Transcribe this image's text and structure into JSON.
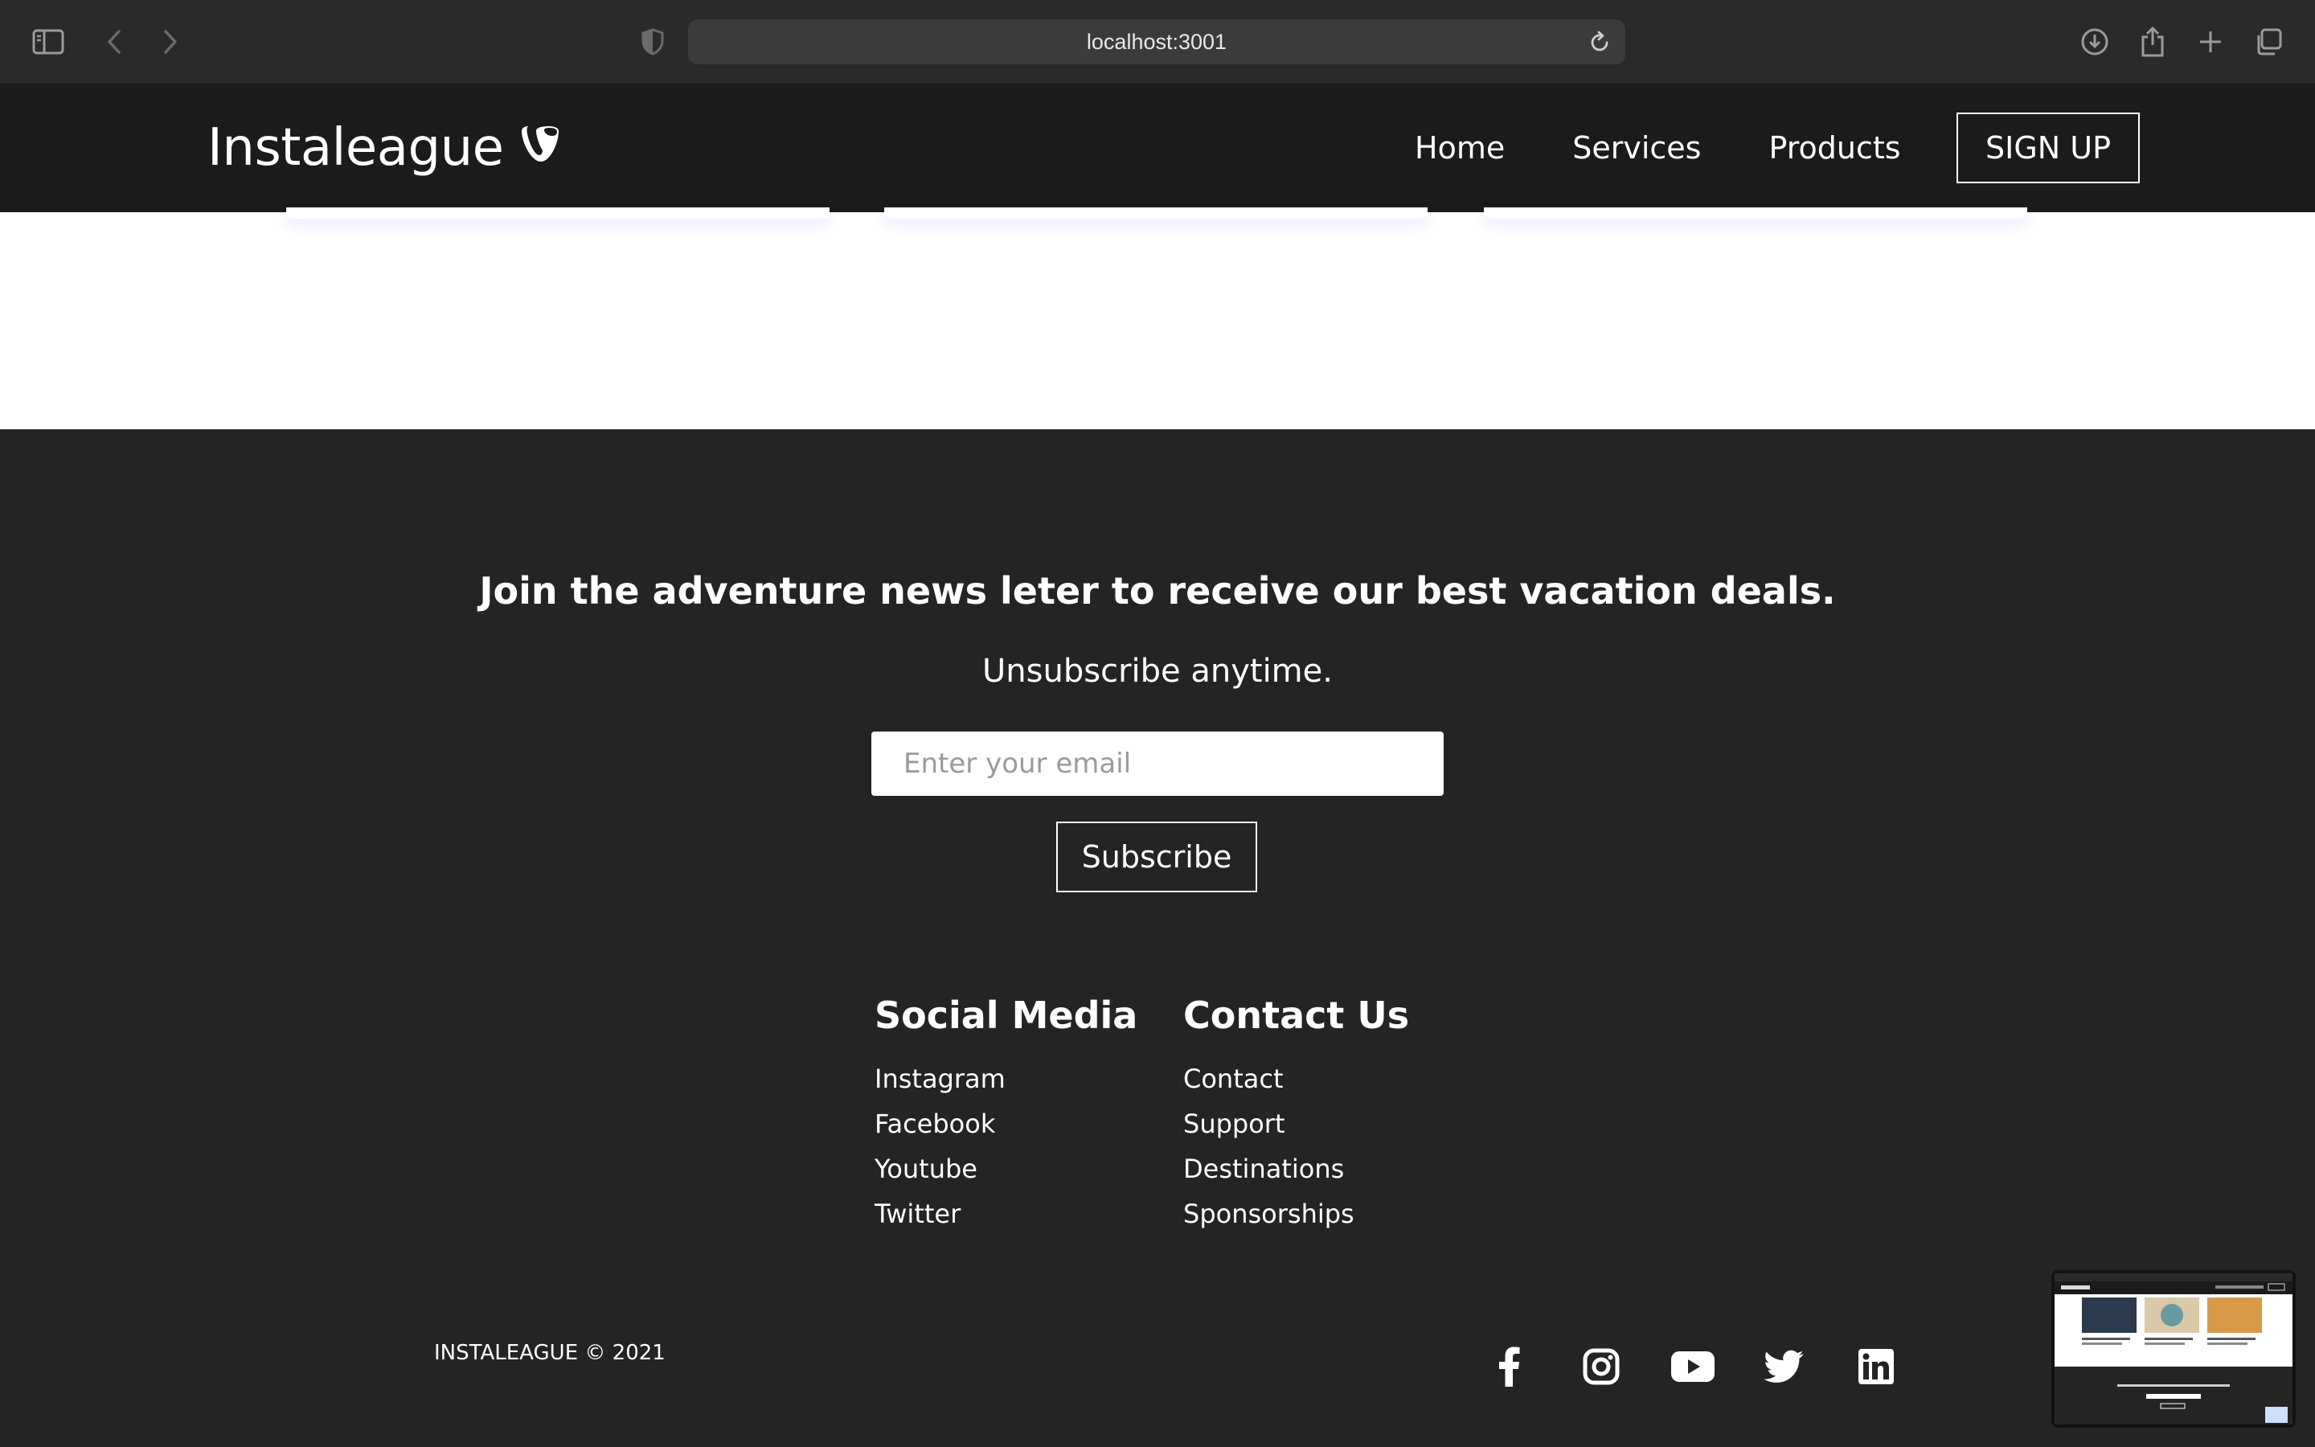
{
  "browser": {
    "url": "localhost:3001",
    "icons": [
      "sidebar-icon",
      "back-icon",
      "forward-icon",
      "shield-icon",
      "reload-icon",
      "download-icon",
      "share-icon",
      "new-tab-icon",
      "tabs-overview-icon"
    ]
  },
  "header": {
    "logo_text": "Instaleague",
    "nav": [
      "Home",
      "Services",
      "Products"
    ],
    "signup_label": "SIGN UP"
  },
  "newsletter": {
    "title": "Join the adventure news leter to receive our best vacation deals.",
    "subtitle": "Unsubscribe anytime.",
    "email_placeholder": "Enter your email",
    "subscribe_label": "Subscribe"
  },
  "footer": {
    "social": {
      "heading": "Social Media",
      "links": [
        "Instagram",
        "Facebook",
        "Youtube",
        "Twitter"
      ]
    },
    "contact": {
      "heading": "Contact Us",
      "links": [
        "Contact",
        "Support",
        "Destinations",
        "Sponsorships"
      ]
    },
    "copyright": "INSTALEAGUE © 2021",
    "social_icons": [
      "facebook-icon",
      "instagram-icon",
      "youtube-icon",
      "twitter-icon",
      "linkedin-icon"
    ]
  },
  "colors": {
    "page_bg": "#242424",
    "header_bg": "#1b1b1b",
    "chrome_bg": "#2a2a2a",
    "text": "#ffffff"
  }
}
